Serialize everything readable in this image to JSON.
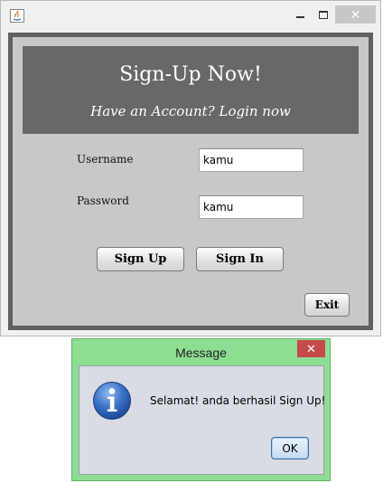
{
  "main_window": {
    "controls": {
      "minimize": "minimize-icon",
      "maximize": "maximize-icon",
      "close": "✕"
    },
    "banner": {
      "title": "Sign-Up Now!",
      "subtitle": "Have an Account? Login now"
    },
    "form": {
      "username_label": "Username",
      "username_value": "kamu",
      "password_label": "Password",
      "password_value": "kamu"
    },
    "buttons": {
      "sign_up": "Sign Up",
      "sign_in": "Sign In",
      "exit": "Exit"
    },
    "colors": {
      "frame": "#616161",
      "banner": "#686868",
      "panel": "#c8c8c8"
    }
  },
  "dialog": {
    "title": "Message",
    "close": "✕",
    "icon": "info-icon",
    "message": "Selamat! anda berhasil Sign Up!",
    "ok_label": "OK",
    "colors": {
      "frame": "#8ddd93",
      "close": "#c54a4a",
      "body": "#d9dce3"
    }
  }
}
